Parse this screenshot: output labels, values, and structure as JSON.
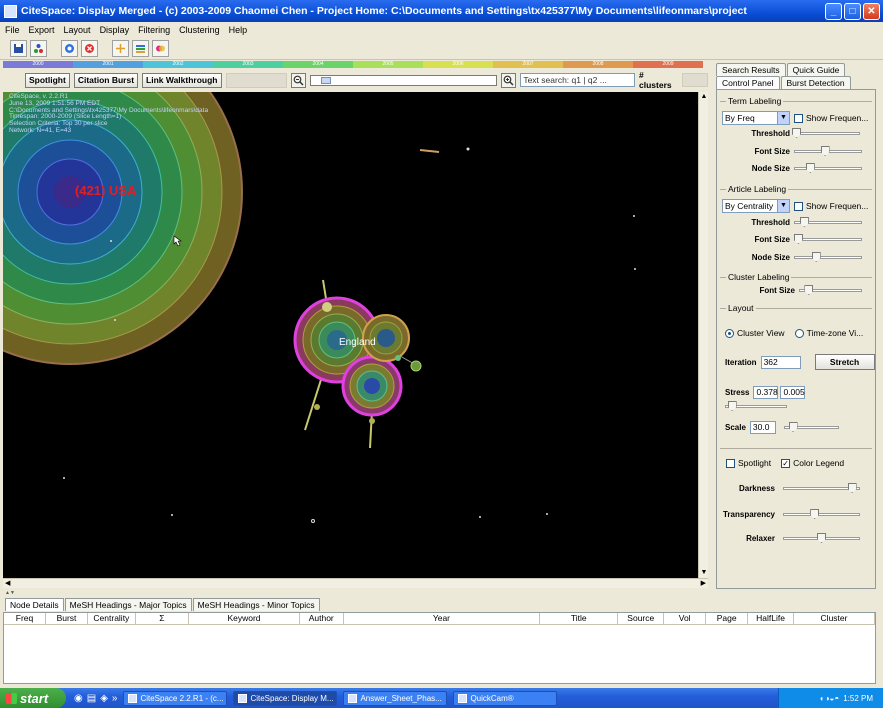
{
  "window": {
    "title": "CiteSpace: Display Merged - (c) 2003-2009 Chaomei Chen - Project Home: C:\\Documents and Settings\\tx425377\\My Documents\\lifeonmars\\project",
    "minimize": "_",
    "maximize": "□",
    "close": "✕"
  },
  "menu": [
    "File",
    "Export",
    "Layout",
    "Display",
    "Filtering",
    "Clustering",
    "Help"
  ],
  "toolbar_icons": [
    "save-icon",
    "nodes-icon",
    "refresh-icon",
    "stop-icon",
    "grid-icon",
    "layers-icon",
    "palette-icon"
  ],
  "timeline": {
    "years": [
      "2000",
      "2001",
      "2002",
      "2003",
      "2004",
      "2005",
      "2006",
      "2007",
      "2008",
      "2009"
    ],
    "colors": [
      "#7a7ad8",
      "#52a0e0",
      "#4ec4d8",
      "#4ecfa0",
      "#6ad46a",
      "#a8e05a",
      "#d8e050",
      "#e0c050",
      "#e09a50",
      "#e07050"
    ]
  },
  "viz_toolbar": {
    "spotlight": "Spotlight",
    "citation_burst": "Citation Burst",
    "link_walkthrough": "Link Walkthrough",
    "search_text": "Text search: q1 | q2 ...",
    "clusters_label": "# clusters"
  },
  "canvas": {
    "info_lines": [
      "CiteSpace, v. 2.2.R1",
      "June 13, 2009 1:51:56 PM EDT",
      "C:\\Documents and Settings\\tx425377\\My Documents\\lifeonmars\\data",
      "Timespan: 2000-2009 (Slice Length=1)",
      "Selection Criteria: Top 30 per slice",
      "Network: N=41, E=43"
    ],
    "usa_label": "(421) USA",
    "england_label": "England"
  },
  "right_tabs": {
    "row1": [
      "Search Results",
      "Quick Guide"
    ],
    "row2": [
      "Control Panel",
      "Burst Detection"
    ]
  },
  "control_panel": {
    "term_labeling": {
      "title": "Term Labeling",
      "mode": "By Freq",
      "show_freq": "Show Frequen...",
      "threshold": "Threshold",
      "threshold_val": 0.0,
      "font_size": "Font Size",
      "font_size_val": 0.45,
      "node_size": "Node Size",
      "node_size_val": 0.2
    },
    "article_labeling": {
      "title": "Article Labeling",
      "mode": "By Centrality",
      "show_freq": "Show Frequen...",
      "threshold": "Threshold",
      "threshold_val": 0.1,
      "font_size": "Font Size",
      "font_size_val": 0.0,
      "node_size": "Node Size",
      "node_size_val": 0.3
    },
    "cluster_labeling": {
      "title": "Cluster Labeling",
      "font_size": "Font Size",
      "font_size_val": 0.1
    },
    "layout": {
      "title": "Layout",
      "cluster_view": "Cluster View",
      "timezone_view": "Time-zone Vi...",
      "iteration_label": "Iteration",
      "iteration": "362",
      "stretch": "Stretch",
      "stress_label": "Stress",
      "stress": "0.378",
      "stress2": "0.005",
      "stress_slider_val": 0.05,
      "scale_label": "Scale",
      "scale": "30.0",
      "scale_slider_val": 0.1
    },
    "display": {
      "spotlight": "Spotlight",
      "color_legend": "Color Legend",
      "darkness": "Darkness",
      "darkness_val": 0.95,
      "transparency": "Transparency",
      "transparency_val": 0.4,
      "relaxer": "Relaxer",
      "relaxer_val": 0.5
    }
  },
  "bottom_tabs": [
    "Node Details",
    "MeSH Headings - Major Topics",
    "MeSH Headings - Minor Topics"
  ],
  "table_columns": [
    "Freq",
    "Burst",
    "Centrality",
    "Σ",
    "Keyword",
    "Author",
    "Year",
    "Title",
    "Source",
    "Vol",
    "Page",
    "HalfLife",
    "Cluster"
  ],
  "taskbar": {
    "start": "start",
    "tasks": [
      "CiteSpace 2.2.R1 - (c...",
      "CiteSpace: Display M...",
      "Answer_Sheet_Phas...",
      "QuickCam®"
    ],
    "clock": "1:52 PM"
  }
}
